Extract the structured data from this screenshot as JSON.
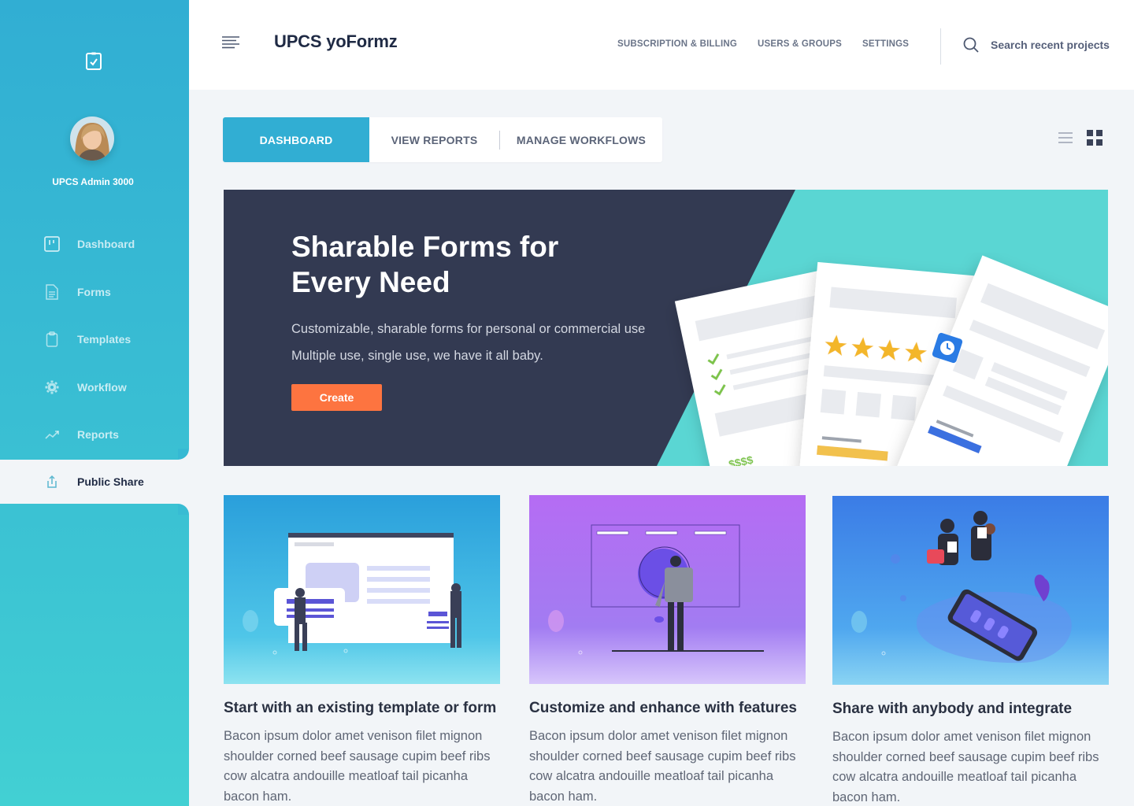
{
  "sidebar": {
    "admin_name": "UPCS Admin 3000",
    "items": [
      {
        "label": "Dashboard",
        "icon": "dashboard-icon"
      },
      {
        "label": "Forms",
        "icon": "document-icon"
      },
      {
        "label": "Templates",
        "icon": "clipboard-icon"
      },
      {
        "label": "Workflow",
        "icon": "gear-icon"
      },
      {
        "label": "Reports",
        "icon": "trend-icon"
      },
      {
        "label": "Public Share",
        "icon": "share-icon",
        "active": true
      }
    ]
  },
  "header": {
    "title": "UPCS yoFormz",
    "links": [
      "SUBSCRIPTION & BILLING",
      "USERS & GROUPS",
      "SETTINGS"
    ],
    "search_placeholder": "Search recent projects"
  },
  "tabs": [
    "DASHBOARD",
    "VIEW REPORTS",
    "MANAGE WORKFLOWS"
  ],
  "hero": {
    "title": "Sharable Forms for Every Need",
    "subtitle_1": "Customizable, sharable forms for personal or commercial use",
    "subtitle_2": "Multiple use, single use, we have it all baby.",
    "button": "Create",
    "price_tag": "$$$$"
  },
  "cards": [
    {
      "title": "Start with an existing template or form",
      "text": "Bacon ipsum dolor amet venison filet mignon shoulder corned beef sausage cupim beef ribs cow alcatra andouille meatloaf tail picanha bacon ham."
    },
    {
      "title": "Customize and enhance with features",
      "text": "Bacon ipsum dolor amet venison filet mignon shoulder corned beef sausage cupim beef ribs cow alcatra andouille meatloaf tail picanha bacon ham."
    },
    {
      "title": "Share with anybody and integrate",
      "text": "Bacon ipsum dolor amet venison filet mignon shoulder corned beef sausage cupim beef ribs cow alcatra andouille meatloaf tail picanha bacon ham."
    }
  ],
  "colors": {
    "sidebar": "#31aed3",
    "accent_button": "#fd7440",
    "hero_dark": "#333a52",
    "hero_teal": "#5ad6d3"
  }
}
